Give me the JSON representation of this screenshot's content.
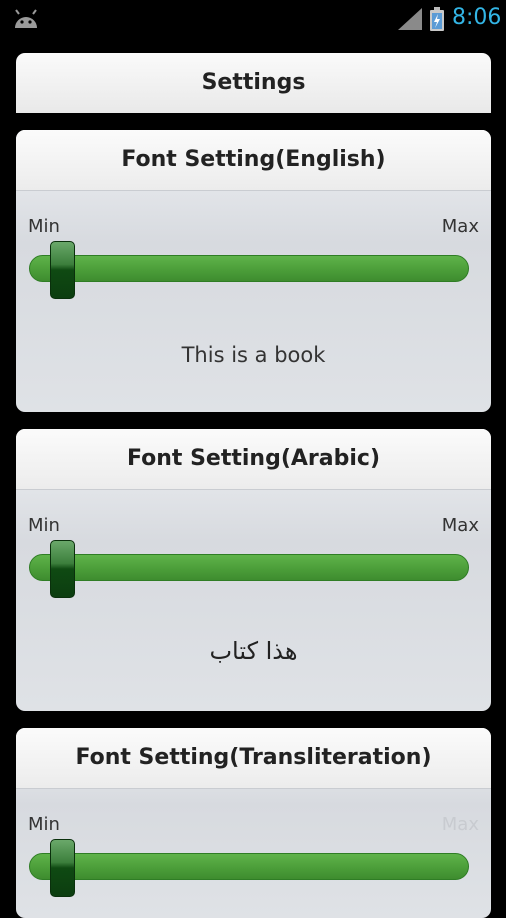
{
  "status_bar": {
    "time": "8:06",
    "icons": [
      "android-icon",
      "signal-icon",
      "battery-icon"
    ],
    "clock_color": "#33b5e5"
  },
  "header": {
    "title": "Settings"
  },
  "font_settings": [
    {
      "title": "Font Setting(English)",
      "min_label": "Min",
      "max_label": "Max",
      "level": 0.05,
      "sample": "This is a book"
    },
    {
      "title": "Font Setting(Arabic)",
      "min_label": "Min",
      "max_label": "Max",
      "level": 0.05,
      "sample": "هذا كتاب"
    },
    {
      "title": "Font Setting(Transliteration)",
      "min_label": "Min",
      "max_label": "Max",
      "level": 0.05
    }
  ],
  "colors": {
    "slider_track": "#4a9c38",
    "slider_thumb": "#0c3d10"
  }
}
